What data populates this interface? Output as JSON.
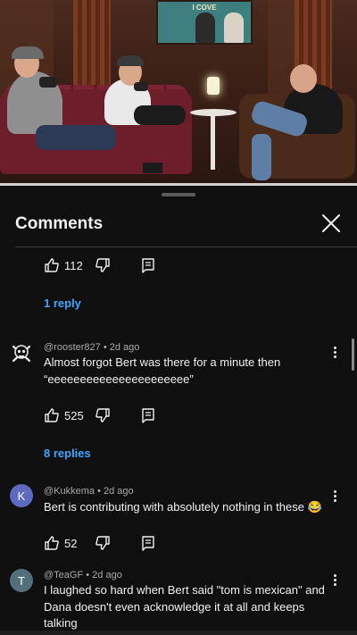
{
  "video": {
    "poster_text": "I COVE",
    "progress": 1.0
  },
  "sheet": {
    "title": "Comments"
  },
  "top_comment_actions": {
    "likes": "112",
    "replies_link": "1 reply"
  },
  "comments": [
    {
      "author": "@rooster827",
      "time": "2d ago",
      "text_line1": "Almost forgot Bert was there for a minute then",
      "text_line2": "“eeeeeeeeeeeeeeeeeeeeee”",
      "likes": "525",
      "replies_link": "8 replies",
      "avatar_icon": "skull-crossbones-icon"
    },
    {
      "author": "@Kukkema",
      "time": "2d ago",
      "text": "Bert is contributing with absolutely nothing in these 😂",
      "likes": "52",
      "avatar_letter": "K",
      "avatar_color": "#5c6bc0"
    },
    {
      "author": "@TeaGF",
      "time": "2d ago",
      "text_line1": "I laughed so hard when Bert said \"tom is mexican\" and",
      "text_line2": "Dana doesn't even acknowledge it at all and keeps",
      "text_line3": "talking",
      "avatar_letter": "T",
      "avatar_color": "#546e7a"
    }
  ],
  "colors": {
    "background": "#0f0f0f",
    "link": "#3ea6ff",
    "meta": "#aaaaaa"
  }
}
